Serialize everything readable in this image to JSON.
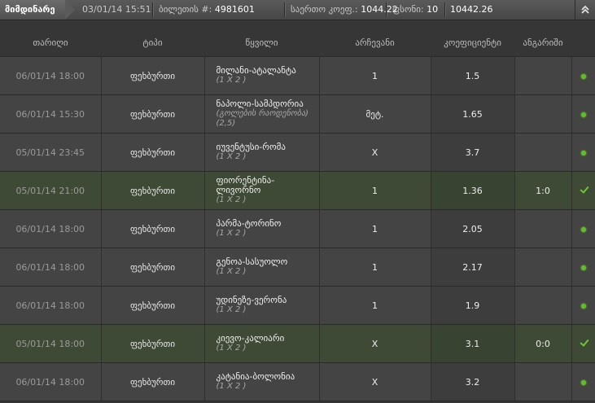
{
  "topbar": {
    "status_label": "მიმდინარე",
    "date_time": "03/01/14 15:51",
    "ticket_label": "ბილეთის #:",
    "ticket_number": "4981601",
    "total_odds_label": "საერთო კოეფ.:",
    "total_odds_value": "1044.22",
    "stake_label": "ფსონი:",
    "stake_value": "10",
    "payout_value": "10442.26",
    "collapse_icon": "chevron-double-up-icon"
  },
  "columns": {
    "date": "თარიღი",
    "type": "ტიპი",
    "event": "წყვილი",
    "choice": "არჩევანი",
    "odds": "კოეფიციენტი",
    "result": "ანგარიში"
  },
  "colors": {
    "accent_green": "#5fbf24",
    "won_row": "#3f4a36",
    "row_bg": "#444444"
  },
  "rows": [
    {
      "date": "06/01/14 18:00",
      "type": "ფეხბურთი",
      "event": "მილანი-ატალანტა",
      "market": "(1 X 2 )",
      "choice": "1",
      "odds": "1.5",
      "result": "",
      "status": "pending"
    },
    {
      "date": "06/01/14 15:30",
      "type": "ფეხბურთი",
      "event": "ნაპოლი-სამპდორია",
      "market": "(გოლების რაოდენობა) (2,5)",
      "choice": "მეტ.",
      "odds": "1.65",
      "result": "",
      "status": "pending"
    },
    {
      "date": "05/01/14 23:45",
      "type": "ფეხბურთი",
      "event": "იუვენტუსი-რომა",
      "market": "(1 X 2 )",
      "choice": "X",
      "odds": "3.7",
      "result": "",
      "status": "pending"
    },
    {
      "date": "05/01/14 21:00",
      "type": "ფეხბურთი",
      "event": "ფიორენტინა-ლივორნო",
      "market": "(1 X 2 )",
      "choice": "1",
      "odds": "1.36",
      "result": "1:0",
      "status": "won"
    },
    {
      "date": "06/01/14 18:00",
      "type": "ფეხბურთი",
      "event": "პარმა-ტორინო",
      "market": "(1 X 2 )",
      "choice": "1",
      "odds": "2.05",
      "result": "",
      "status": "pending"
    },
    {
      "date": "06/01/14 18:00",
      "type": "ფეხბურთი",
      "event": "გენოა-სასუოლო",
      "market": "(1 X 2 )",
      "choice": "1",
      "odds": "2.17",
      "result": "",
      "status": "pending"
    },
    {
      "date": "06/01/14 18:00",
      "type": "ფეხბურთი",
      "event": "უდინეზე-ვერონა",
      "market": "(1 X 2 )",
      "choice": "1",
      "odds": "1.9",
      "result": "",
      "status": "pending"
    },
    {
      "date": "05/01/14 18:00",
      "type": "ფეხბურთი",
      "event": "კიევო-კალიარი",
      "market": "(1 X 2 )",
      "choice": "X",
      "odds": "3.1",
      "result": "0:0",
      "status": "won"
    },
    {
      "date": "06/01/14 18:00",
      "type": "ფეხბურთი",
      "event": "კატანია-ბოლონია",
      "market": "(1 X 2 )",
      "choice": "X",
      "odds": "3.2",
      "result": "",
      "status": "pending"
    }
  ]
}
